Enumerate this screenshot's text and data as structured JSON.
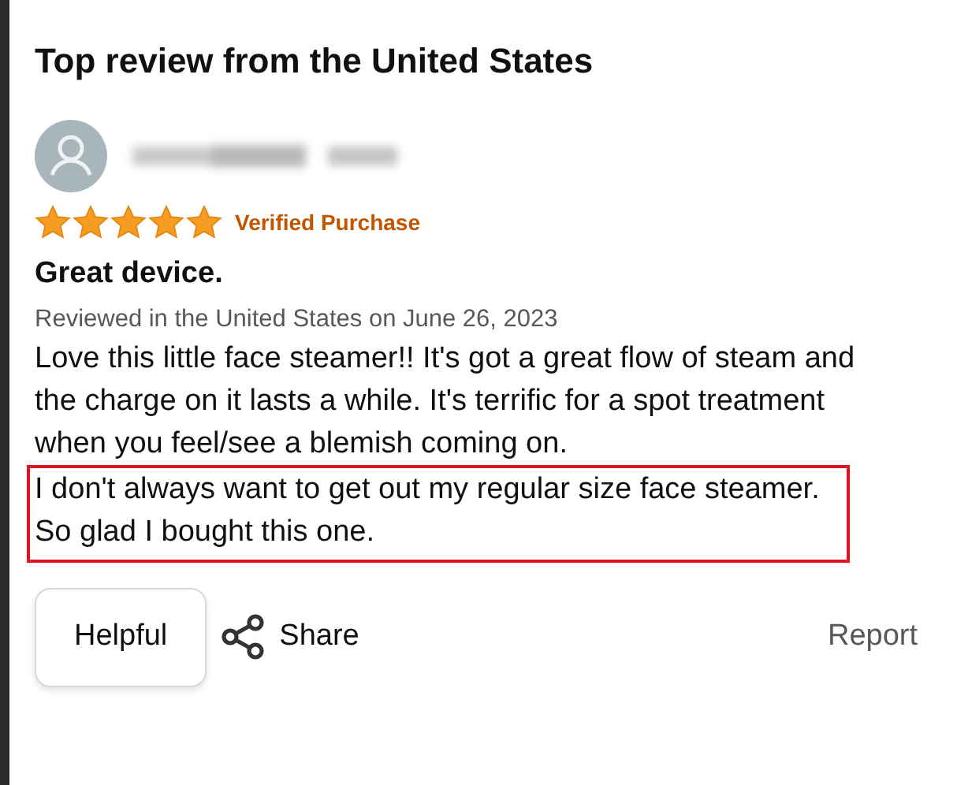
{
  "heading": "Top review from the United States",
  "review": {
    "stars": 5,
    "badge": "Verified Purchase",
    "title": "Great device.",
    "date": "Reviewed in the United States on June 26, 2023",
    "body": [
      {
        "text": "Love this little face steamer!! It's got a great flow of steam and the charge on it lasts a while. It's terrific for a spot treatment when you feel/see a blemish coming on.",
        "highlighted": false
      },
      {
        "text": "I don't always want to get out my regular size face steamer. So glad I bought this one.",
        "highlighted": true
      }
    ]
  },
  "actions": {
    "helpful": "Helpful",
    "share": "Share",
    "report": "Report"
  }
}
